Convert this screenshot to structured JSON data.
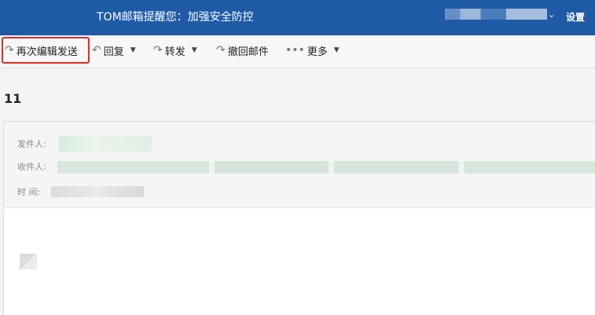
{
  "header": {
    "notice": "TOM邮箱提醒您：加强安全防控",
    "settings_label": "设置"
  },
  "toolbar": {
    "resend_label": "再次编辑发送",
    "reply_label": "回复",
    "forward_label": "转发",
    "recall_label": "撤回邮件",
    "more_label": "更多"
  },
  "mail": {
    "subject": "11",
    "sender_label": "发件人:",
    "recipient_label": "收件人:",
    "time_label": "时  间:"
  },
  "colors": {
    "header_bg": "#1e5aa6",
    "highlight": "#e02a2a"
  },
  "icons": [
    "forward-arrow-icon",
    "reply-arrow-icon",
    "more-dots-icon",
    "chevron-down-icon"
  ]
}
